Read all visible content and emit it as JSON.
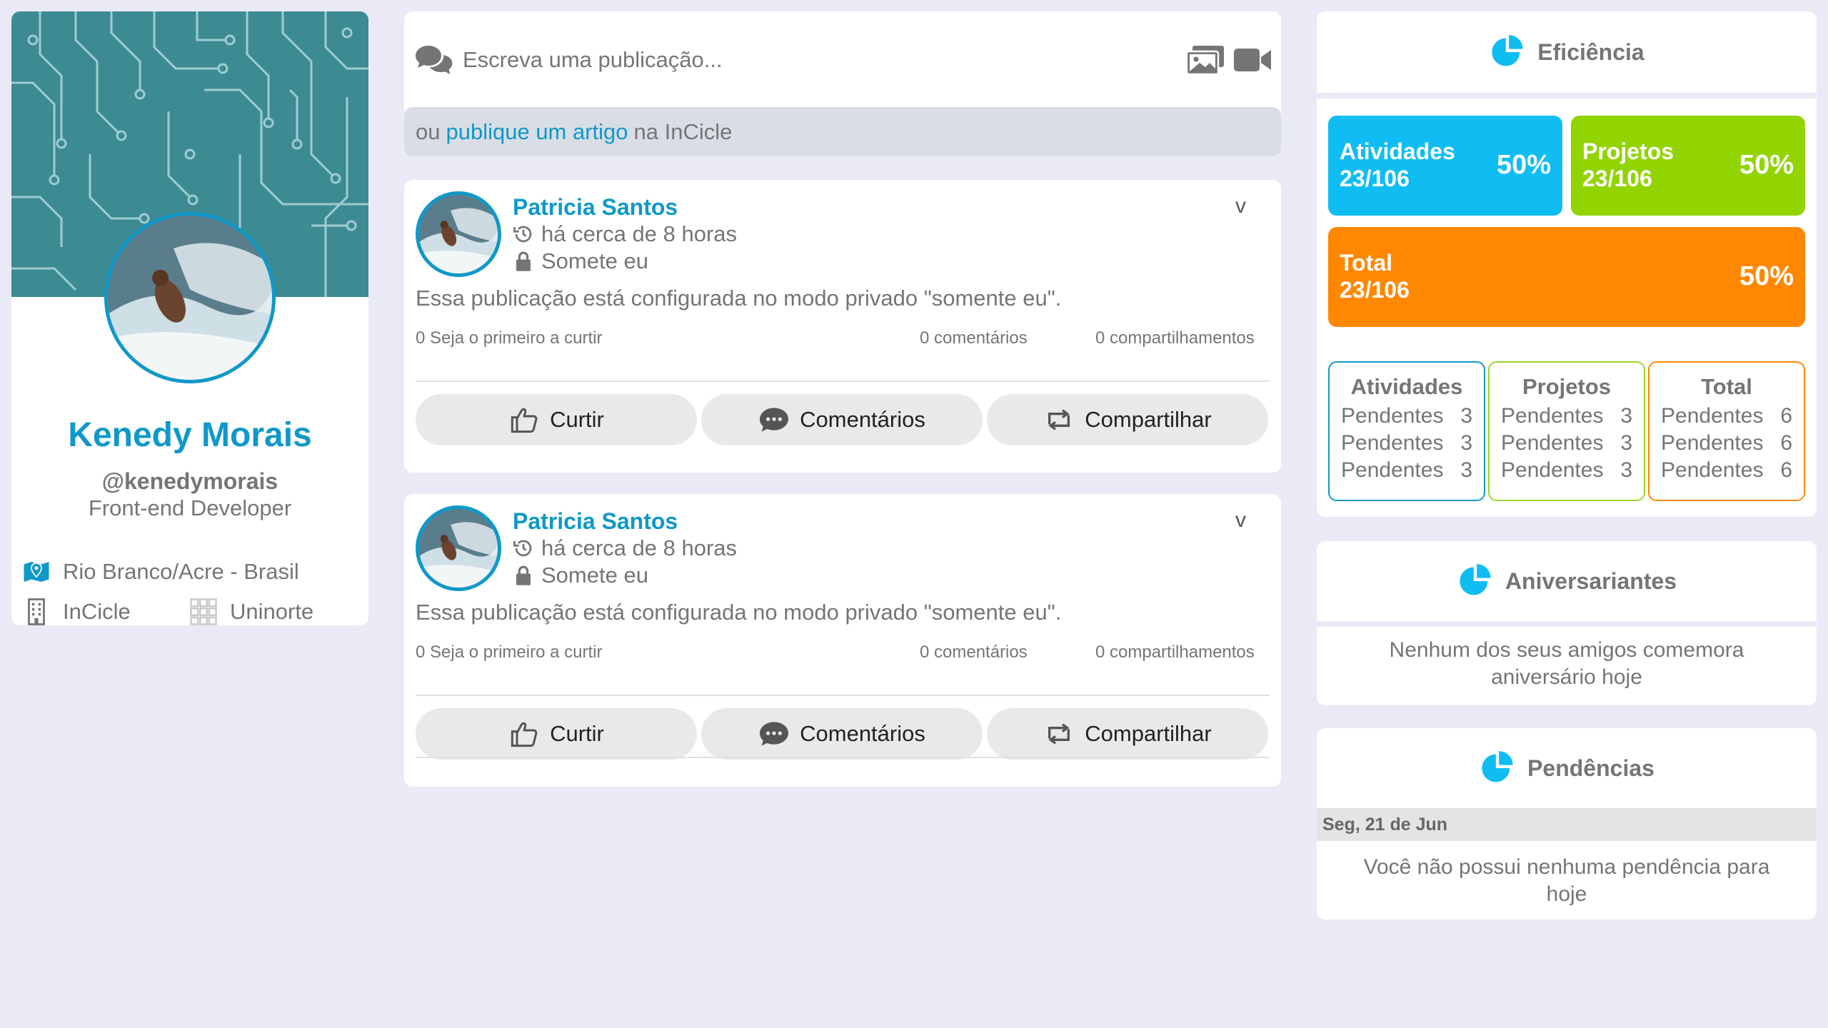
{
  "profile": {
    "name": "Kenedy Morais",
    "handle": "@kenedymorais",
    "role": "Front-end Developer",
    "location": "Rio Branco/Acre - Brasil",
    "company": "InCicle",
    "university": "Uninorte"
  },
  "composer": {
    "placeholder": "Escreva uma publicação...",
    "footer_prefix": "ou",
    "footer_link": "publique um artigo",
    "footer_suffix": "na InCicle"
  },
  "posts": [
    {
      "author": "Patricia Santos",
      "time": "há cerca de 8 horas",
      "visibility": "Somete eu",
      "menu": "v",
      "text": "Essa publicação está configurada no modo privado \"somente eu\".",
      "likes": "0 Seja o primeiro a curtir",
      "comments": "0 comentários",
      "shares": "0 compartilhamentos",
      "like_label": "Curtir",
      "comment_label": "Comentários",
      "share_label": "Compartilhar"
    },
    {
      "author": "Patricia Santos",
      "time": "há cerca de 8 horas",
      "visibility": "Somete eu",
      "menu": "v",
      "text": "Essa publicação está configurada no modo privado \"somente eu\".",
      "likes": "0 Seja o primeiro a curtir",
      "comments": "0 comentários",
      "shares": "0 compartilhamentos",
      "like_label": "Curtir",
      "comment_label": "Comentários",
      "share_label": "Compartilhar"
    }
  ],
  "efficiency": {
    "title": "Eficiência",
    "tiles": [
      {
        "label": "Atividades",
        "count": "23/106",
        "percent": "50%",
        "color": "#10bdf2"
      },
      {
        "label": "Projetos",
        "count": "23/106",
        "percent": "50%",
        "color": "#92d400"
      },
      {
        "label": "Total",
        "count": "23/106",
        "percent": "50%",
        "color": "#ff8800"
      }
    ],
    "boxes": [
      {
        "title": "Atividades",
        "color": "#0f98c9",
        "rows": [
          {
            "label": "Pendentes",
            "value": "3"
          },
          {
            "label": "Pendentes",
            "value": "3"
          },
          {
            "label": "Pendentes",
            "value": "3"
          }
        ]
      },
      {
        "title": "Projetos",
        "color": "#9ad82c",
        "rows": [
          {
            "label": "Pendentes",
            "value": "3"
          },
          {
            "label": "Pendentes",
            "value": "3"
          },
          {
            "label": "Pendentes",
            "value": "3"
          }
        ]
      },
      {
        "title": "Total",
        "color": "#ff8800",
        "rows": [
          {
            "label": "Pendentes",
            "value": "6"
          },
          {
            "label": "Pendentes",
            "value": "6"
          },
          {
            "label": "Pendentes",
            "value": "6"
          }
        ]
      }
    ]
  },
  "birthdays": {
    "title": "Aniversariantes",
    "line1": "Nenhum dos seus amigos comemora",
    "line2": "aniversário hoje"
  },
  "pending": {
    "title": "Pendências",
    "date": "Seg, 21 de Jun",
    "line1": "Você não possui nenhuma pendência para",
    "line2": "hoje"
  },
  "colors": {
    "accent": "#0f98c9",
    "page_bg": "#e9eaf5",
    "chart_icon": "#10bdf2"
  }
}
